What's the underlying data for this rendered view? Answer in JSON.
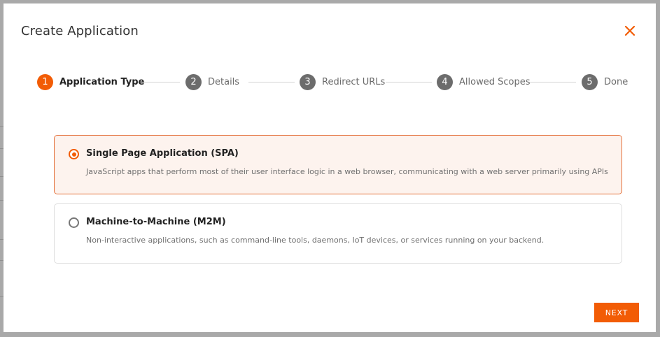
{
  "dialog": {
    "title": "Create Application",
    "close_icon": "close-icon"
  },
  "stepper": {
    "active_index": 0,
    "steps": [
      {
        "number": "1",
        "label": "Application Type"
      },
      {
        "number": "2",
        "label": "Details"
      },
      {
        "number": "3",
        "label": "Redirect URLs"
      },
      {
        "number": "4",
        "label": "Allowed Scopes"
      },
      {
        "number": "5",
        "label": "Done"
      }
    ]
  },
  "options": [
    {
      "title": "Single Page Application (SPA)",
      "description": "JavaScript apps that perform most of their user interface logic in a web browser, communicating with a web server primarily using APIs",
      "selected": true
    },
    {
      "title": "Machine-to-Machine (M2M)",
      "description": "Non-interactive applications, such as command-line tools, daemons, IoT devices, or services running on your backend.",
      "selected": false
    }
  ],
  "footer": {
    "next_label": "NEXT"
  },
  "colors": {
    "accent": "#f25c05",
    "step_inactive": "#6c6c6c",
    "selected_bg": "#fdf3ee",
    "selected_border": "#e4703a"
  }
}
